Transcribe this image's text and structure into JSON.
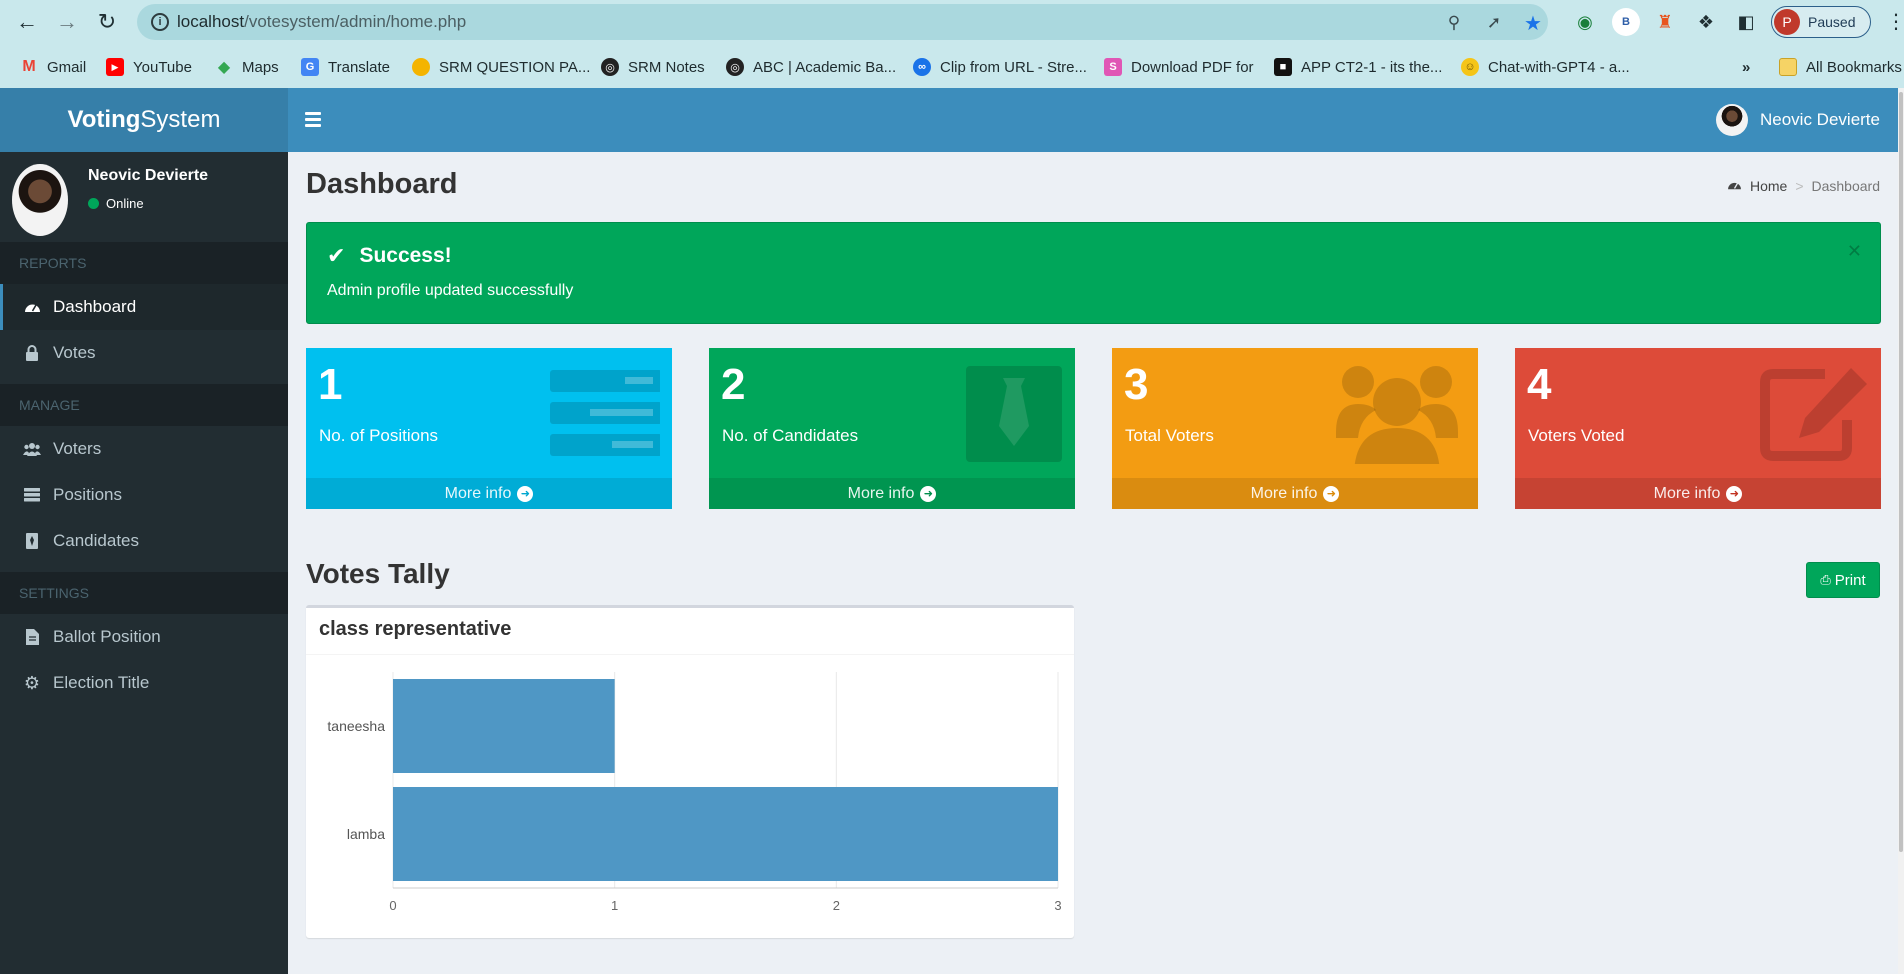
{
  "browser": {
    "url_host": "localhost",
    "url_path": "/votesystem/admin/home.php",
    "profile_initial": "P",
    "profile_status": "Paused",
    "ext_b": "B",
    "bookmarks": [
      {
        "label": "Gmail",
        "icon": "gmail-icon",
        "color": "#ea4335"
      },
      {
        "label": "YouTube",
        "icon": "youtube-icon",
        "color": "#ff0000"
      },
      {
        "label": "Maps",
        "icon": "maps-icon",
        "color": "#34a853"
      },
      {
        "label": "Translate",
        "icon": "translate-icon",
        "color": "#4285f4"
      },
      {
        "label": "SRM QUESTION PA...",
        "icon": "srm-question-icon",
        "color": "#f4b400"
      },
      {
        "label": "SRM Notes",
        "icon": "globe-icon",
        "color": "#222"
      },
      {
        "label": "ABC | Academic Ba...",
        "icon": "globe-icon",
        "color": "#222"
      },
      {
        "label": "Clip from URL - Stre...",
        "icon": "clip-icon",
        "color": "#1a73e8"
      },
      {
        "label": "Download PDF for",
        "icon": "pdf-icon",
        "color": "#e056b5"
      },
      {
        "label": "APP CT2-1 - its the...",
        "icon": "app-icon",
        "color": "#111"
      },
      {
        "label": "Chat-with-GPT4 - a...",
        "icon": "hugging-face-icon",
        "color": "#f5c518"
      }
    ],
    "all_bookmarks": "All Bookmarks"
  },
  "app": {
    "logo_bold": "Voting",
    "logo_rest": "System",
    "user_name": "Neovic Devierte",
    "status": "Online"
  },
  "sidebar": {
    "sections": [
      "REPORTS",
      "MANAGE",
      "SETTINGS"
    ],
    "items": [
      {
        "label": "Dashboard",
        "icon": "dashboard-icon"
      },
      {
        "label": "Votes",
        "icon": "lock-icon"
      },
      {
        "label": "Voters",
        "icon": "users-icon"
      },
      {
        "label": "Positions",
        "icon": "tasks-icon"
      },
      {
        "label": "Candidates",
        "icon": "tie-icon"
      },
      {
        "label": "Ballot Position",
        "icon": "file-icon"
      },
      {
        "label": "Election Title",
        "icon": "cog-icon"
      }
    ]
  },
  "page": {
    "title": "Dashboard",
    "breadcrumb_home": "Home",
    "breadcrumb_current": "Dashboard"
  },
  "alert": {
    "title": "Success!",
    "message": "Admin profile updated successfully"
  },
  "stats": [
    {
      "value": "1",
      "label": "No. of Positions",
      "color": "#00c0ef",
      "icon": "tasks-icon"
    },
    {
      "value": "2",
      "label": "No. of Candidates",
      "color": "#00a65a",
      "icon": "tie-icon"
    },
    {
      "value": "3",
      "label": "Total Voters",
      "color": "#f39c12",
      "icon": "users-icon"
    },
    {
      "value": "4",
      "label": "Voters Voted",
      "color": "#dd4b39",
      "icon": "edit-icon"
    }
  ],
  "more_info": "More info",
  "tally": {
    "title": "Votes Tally",
    "print": "Print"
  },
  "chart_data": {
    "type": "bar",
    "orientation": "horizontal",
    "title": "class representative",
    "categories": [
      "taneesha",
      "lamba"
    ],
    "values": [
      1,
      3
    ],
    "xlim": [
      0,
      3
    ],
    "xticks": [
      0,
      1,
      2,
      3
    ],
    "bar_color": "#4f97c5",
    "grid": true
  }
}
